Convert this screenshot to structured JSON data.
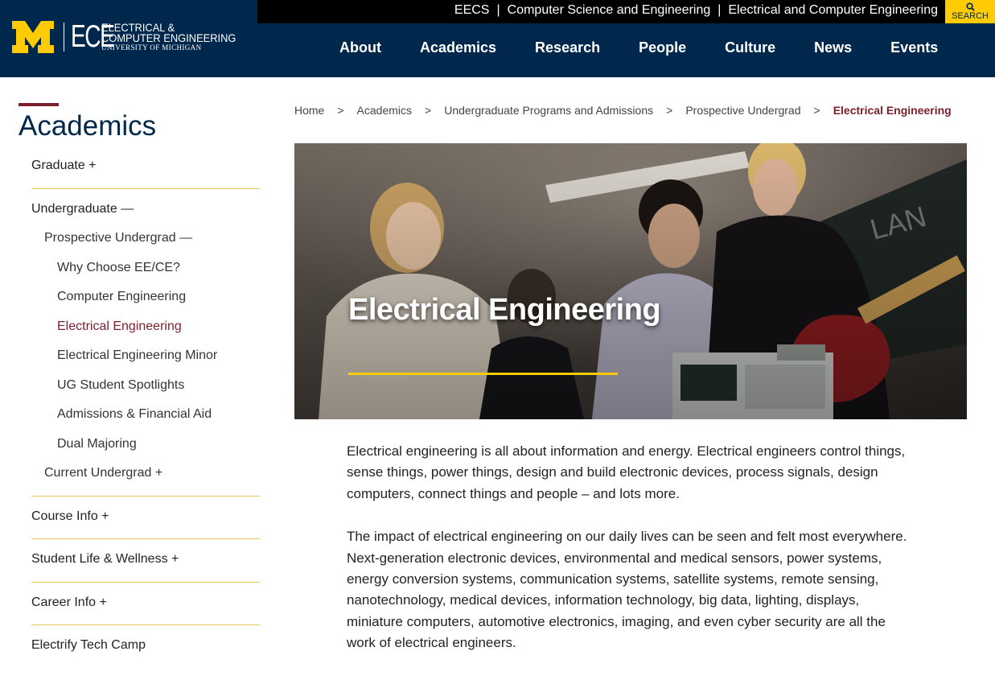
{
  "header": {
    "logo_mark": "ECE",
    "logo_line1": "ELECTRICAL &",
    "logo_line2": "COMPUTER ENGINEERING",
    "logo_line3": "UNIVERSITY OF MICHIGAN",
    "top_links": [
      "EECS",
      "Computer Science and Engineering",
      "Electrical and Computer Engineering"
    ],
    "search_label": "SEARCH",
    "nav": [
      "About",
      "Academics",
      "Research",
      "People",
      "Culture",
      "News",
      "Events"
    ]
  },
  "sidebar": {
    "title": "Academics",
    "items": [
      {
        "label": "Graduate +",
        "level": 1
      },
      {
        "label": "Undergraduate —",
        "level": 1
      },
      {
        "label": "Prospective Undergrad —",
        "level": 2
      },
      {
        "label": "Why Choose EE/CE?",
        "level": 3
      },
      {
        "label": "Computer Engineering",
        "level": 3
      },
      {
        "label": "Electrical Engineering",
        "level": 3,
        "active": true
      },
      {
        "label": "Electrical Engineering Minor",
        "level": 3
      },
      {
        "label": "UG Student Spotlights",
        "level": 3
      },
      {
        "label": "Admissions & Financial Aid",
        "level": 3
      },
      {
        "label": "Dual Majoring",
        "level": 3
      },
      {
        "label": "Current Undergrad +",
        "level": 2
      },
      {
        "label": "Course Info +",
        "level": 1
      },
      {
        "label": "Student Life & Wellness +",
        "level": 1
      },
      {
        "label": "Career Info +",
        "level": 1
      },
      {
        "label": "Electrify Tech Camp",
        "level": 1
      }
    ]
  },
  "breadcrumb": {
    "items": [
      "Home",
      "Academics",
      "Undergraduate Programs and Admissions",
      "Prospective Undergrad"
    ],
    "separator": ">",
    "current": "Electrical Engineering"
  },
  "hero": {
    "title": "Electrical Engineering"
  },
  "content": {
    "paragraphs": [
      "Electrical engineering is all about information and energy. Electrical engineers control things, sense things, power things, design and build electronic devices, process signals, design computers, connect things and people – and lots more.",
      "The impact of electrical engineering on our daily lives can be seen and felt most everywhere. Next-generation electronic devices, environmental and medical sensors, power systems, energy conversion systems, communication systems, satellite systems, remote sensing, nanotechnology, medical devices, information technology, big data, lighting, displays, miniature computers, automotive electronics, imaging, and even cyber security are all the work of electrical engineers."
    ]
  },
  "colors": {
    "navy": "#00274c",
    "maize": "#ffcb05",
    "maroon": "#7a1f2b",
    "divider": "#e8c75a"
  }
}
